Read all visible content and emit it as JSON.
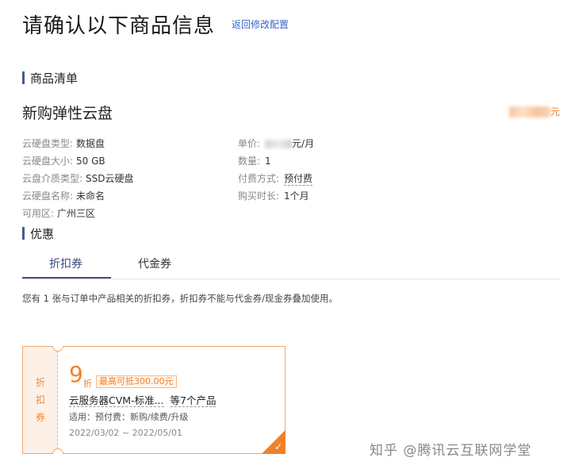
{
  "header": {
    "title": "请确认以下商品信息",
    "back_link": "返回修改配置"
  },
  "sections": {
    "product_list": "商品清单",
    "discount": "优惠"
  },
  "product": {
    "name": "新购弹性云盘",
    "total_suffix": "元",
    "specs_left": [
      {
        "key": "云硬盘类型:",
        "value": "数据盘"
      },
      {
        "key": "云硬盘大小:",
        "value": "50 GB"
      },
      {
        "key": "云盘介质类型:",
        "value": "SSD云硬盘"
      },
      {
        "key": "云硬盘名称:",
        "value": "未命名"
      },
      {
        "key": "可用区:",
        "value": "广州三区"
      }
    ],
    "unit_price_key": "单价:",
    "unit_price_suffix": "元/月",
    "quantity_key": "数量:",
    "quantity_value": "1",
    "payment_key": "付费方式:",
    "payment_value": "预付费",
    "duration_key": "购买时长:",
    "duration_value": "1个月"
  },
  "tabs": [
    "折扣券",
    "代金券"
  ],
  "note": "您有 1 张与订单中产品相关的折扣券，折扣券不能与代金券/现金券叠加使用。",
  "coupon": {
    "type_chars": [
      "折",
      "扣",
      "券"
    ],
    "discount": "9",
    "discount_unit": "折",
    "max": "最高可抵300.00元",
    "product": "云服务器CVM-标准...",
    "product_more": "等7个产品",
    "usage": "适用：预付费：新购/续费/升级",
    "date": "2022/03/02 ~ 2022/05/01",
    "check": "✓"
  },
  "watermark": "知乎 @腾讯云互联网学堂",
  "colors": {
    "accent": "#f0812a",
    "link": "#3a64c8",
    "tab_active": "#3f4f88"
  }
}
